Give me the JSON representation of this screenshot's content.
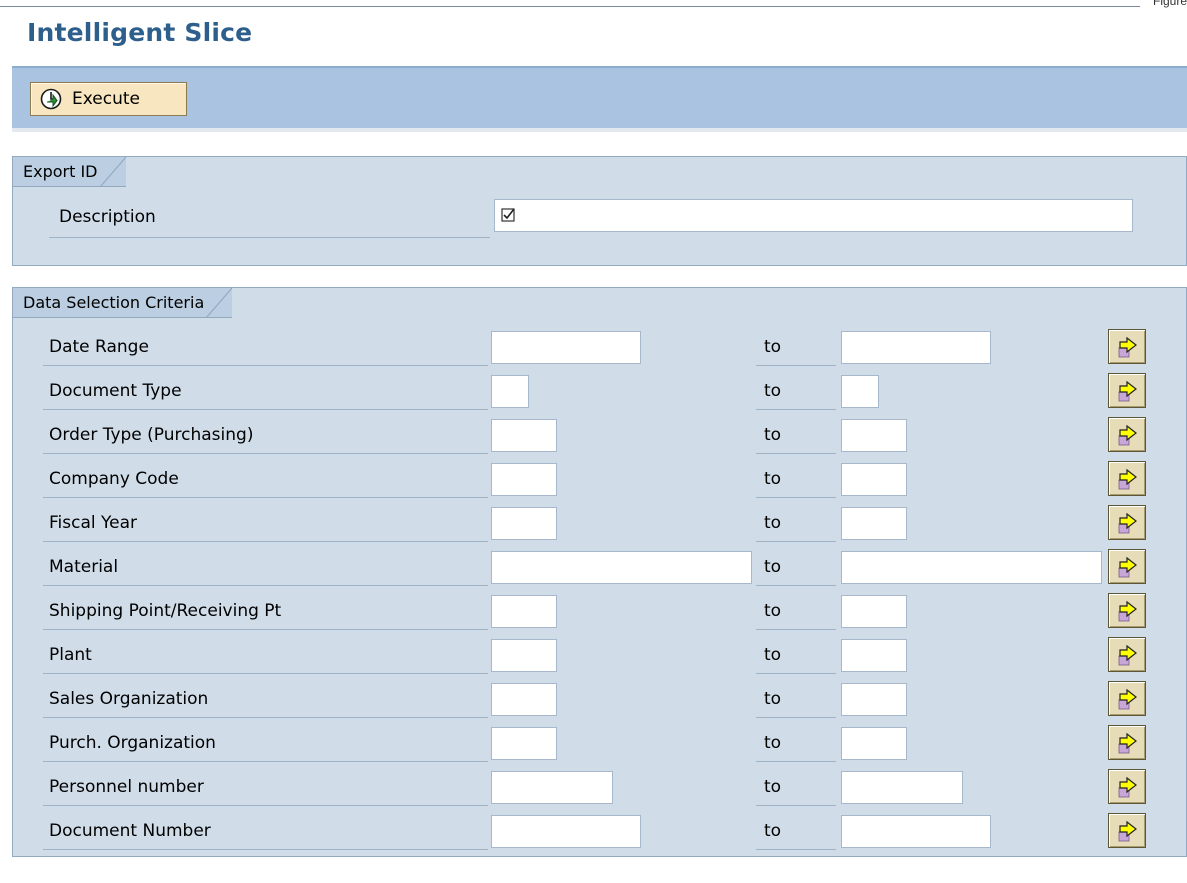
{
  "page": {
    "title": "Intelligent Slice",
    "corner_text": "Figure"
  },
  "toolbar": {
    "execute_label": "Execute"
  },
  "export_id": {
    "tab_label": "Export ID",
    "description_label": "Description",
    "description_checked": true
  },
  "selection": {
    "tab_label": "Data Selection Criteria",
    "to_label": "to",
    "rows": [
      {
        "label": "Date Range",
        "from": "",
        "to": ""
      },
      {
        "label": "Document Type",
        "from": "",
        "to": ""
      },
      {
        "label": "Order Type (Purchasing)",
        "from": "",
        "to": ""
      },
      {
        "label": "Company Code",
        "from": "",
        "to": ""
      },
      {
        "label": "Fiscal Year",
        "from": "",
        "to": ""
      },
      {
        "label": "Material",
        "from": "",
        "to": ""
      },
      {
        "label": "Shipping Point/Receiving Pt",
        "from": "",
        "to": ""
      },
      {
        "label": "Plant",
        "from": "",
        "to": ""
      },
      {
        "label": "Sales Organization",
        "from": "",
        "to": ""
      },
      {
        "label": "Purch. Organization",
        "from": "",
        "to": ""
      },
      {
        "label": "Personnel number",
        "from": "",
        "to": ""
      },
      {
        "label": "Document Number",
        "from": "",
        "to": ""
      }
    ]
  },
  "icons": {
    "execute": "execute-clock-icon",
    "multiple_selection": "multiple-selection-arrow-icon",
    "checkbox": "checkbox-checked-icon"
  },
  "colors": {
    "title": "#2e5f8c",
    "toolbar": "#a9c3e1",
    "panel": "#d0dde9",
    "arrow": "#ffff00"
  }
}
